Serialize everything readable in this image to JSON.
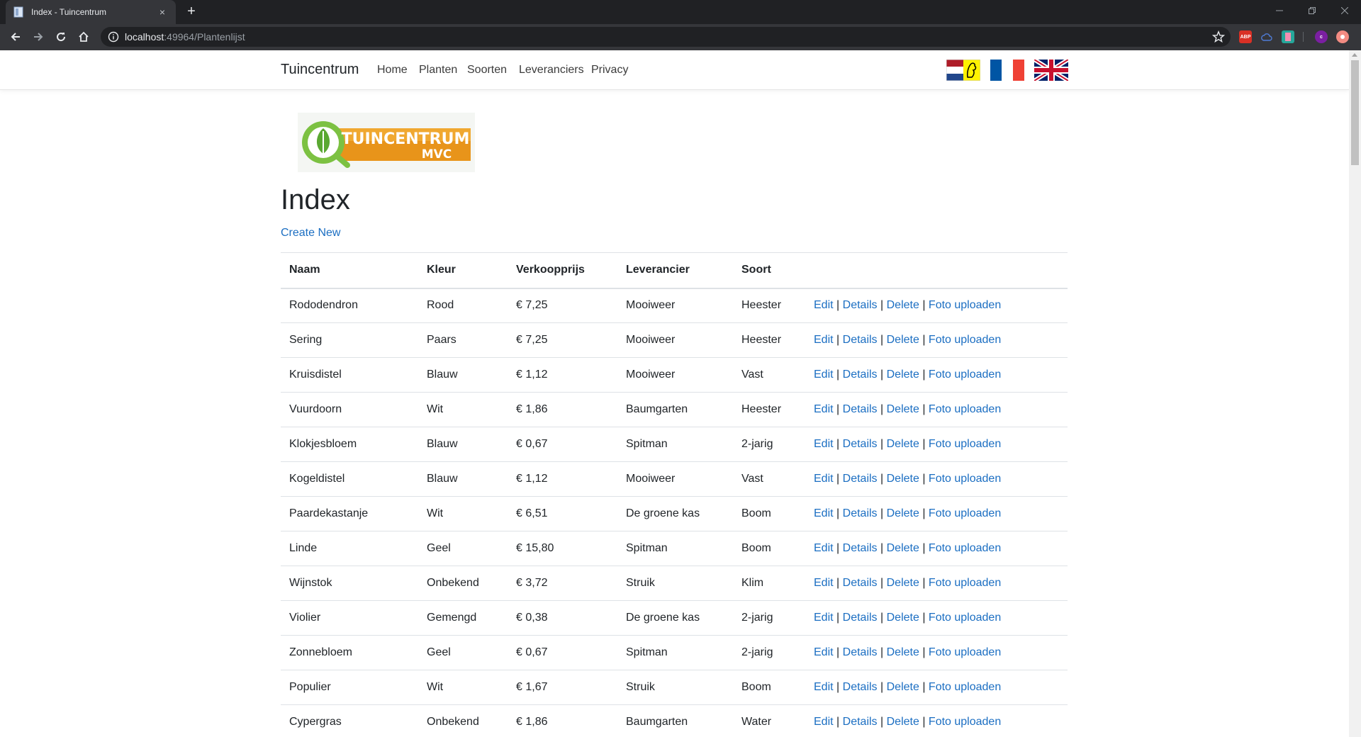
{
  "browser": {
    "tab_title": "Index - Tuincentrum",
    "new_tab": "+",
    "tab_close": "×",
    "url_host": "localhost",
    "url_path": ":49964/Plantenlijst",
    "extensions": [
      "ABP",
      "",
      "",
      "c",
      ""
    ]
  },
  "nav": {
    "brand": "Tuincentrum",
    "links": [
      "Home",
      "Planten",
      "Soorten",
      "Leveranciers",
      "Privacy"
    ]
  },
  "logo": {
    "line1": "TUINCENTRUM",
    "line2": "MVC"
  },
  "page": {
    "title": "Index",
    "create_new": "Create New"
  },
  "table": {
    "headers": [
      "Naam",
      "Kleur",
      "Verkoopprijs",
      "Leverancier",
      "Soort"
    ],
    "actions": [
      "Edit",
      "Details",
      "Delete",
      "Foto uploaden"
    ],
    "separator": "|",
    "rows": [
      [
        "Rododendron",
        "Rood",
        "€ 7,25",
        "Mooiweer",
        "Heester"
      ],
      [
        "Sering",
        "Paars",
        "€ 7,25",
        "Mooiweer",
        "Heester"
      ],
      [
        "Kruisdistel",
        "Blauw",
        "€ 1,12",
        "Mooiweer",
        "Vast"
      ],
      [
        "Vuurdoorn",
        "Wit",
        "€ 1,86",
        "Baumgarten",
        "Heester"
      ],
      [
        "Klokjesbloem",
        "Blauw",
        "€ 0,67",
        "Spitman",
        "2-jarig"
      ],
      [
        "Kogeldistel",
        "Blauw",
        "€ 1,12",
        "Mooiweer",
        "Vast"
      ],
      [
        "Paardekastanje",
        "Wit",
        "€ 6,51",
        "De groene kas",
        "Boom"
      ],
      [
        "Linde",
        "Geel",
        "€ 15,80",
        "Spitman",
        "Boom"
      ],
      [
        "Wijnstok",
        "Onbekend",
        "€ 3,72",
        "Struik",
        "Klim"
      ],
      [
        "Violier",
        "Gemengd",
        "€ 0,38",
        "De groene kas",
        "2-jarig"
      ],
      [
        "Zonnebloem",
        "Geel",
        "€ 0,67",
        "Spitman",
        "2-jarig"
      ],
      [
        "Populier",
        "Wit",
        "€ 1,67",
        "Struik",
        "Boom"
      ],
      [
        "Cypergras",
        "Onbekend",
        "€ 1,86",
        "Baumgarten",
        "Water"
      ]
    ]
  },
  "colors": {
    "link": "#1b6ec2",
    "chrome_dark": "#202124",
    "chrome_tab": "#35363a"
  }
}
